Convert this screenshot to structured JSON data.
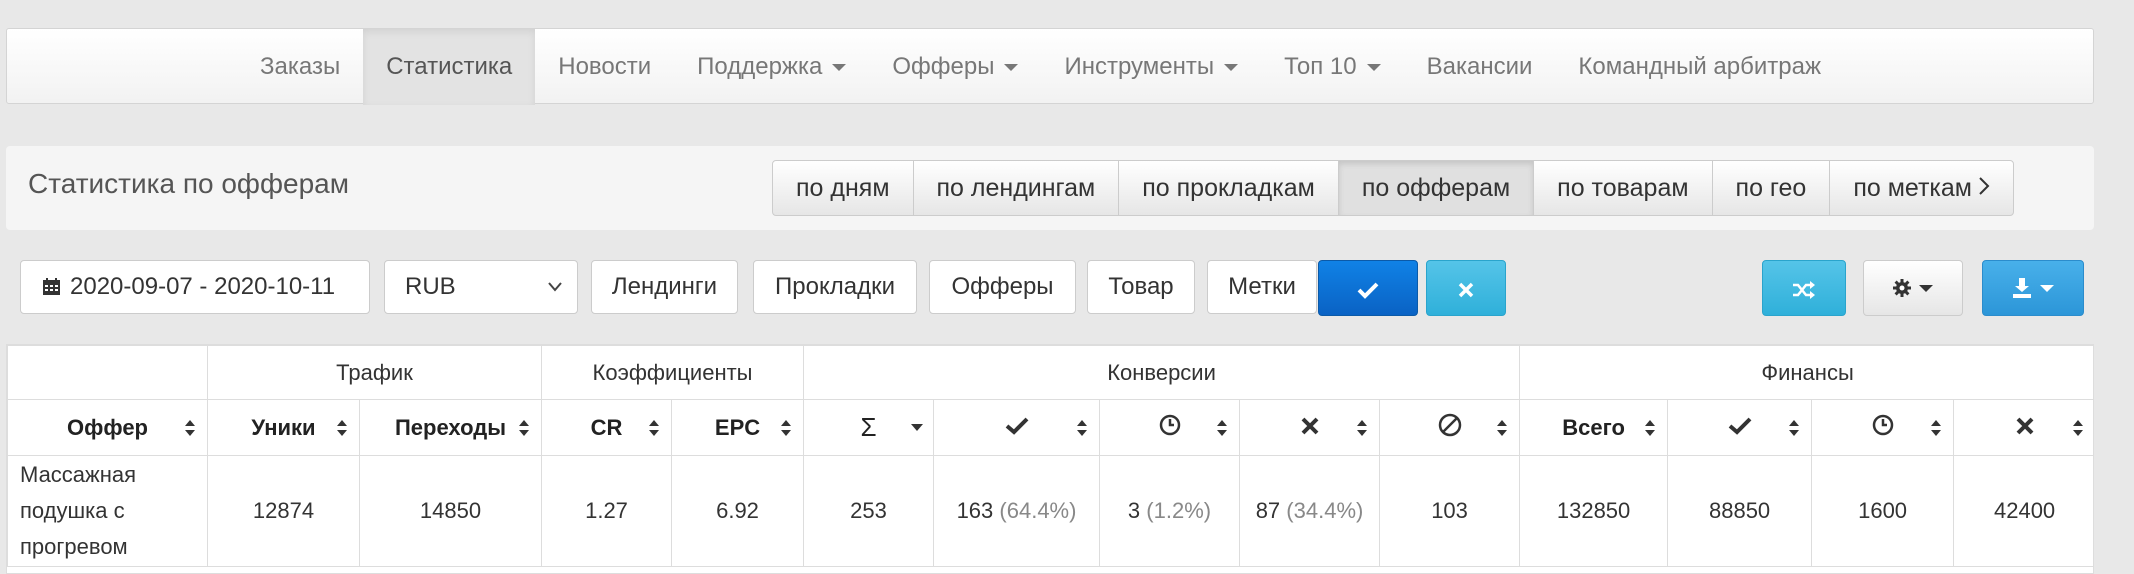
{
  "navbar": {
    "items": [
      {
        "label": "Заказы",
        "dropdown": false
      },
      {
        "label": "Статистика",
        "dropdown": false,
        "active": true
      },
      {
        "label": "Новости",
        "dropdown": false
      },
      {
        "label": "Поддержка",
        "dropdown": true
      },
      {
        "label": "Офферы",
        "dropdown": true
      },
      {
        "label": "Инструменты",
        "dropdown": true
      },
      {
        "label": "Топ 10",
        "dropdown": true
      },
      {
        "label": "Вакансии",
        "dropdown": false
      },
      {
        "label": "Командный арбитраж",
        "dropdown": false
      }
    ]
  },
  "header": {
    "title": "Статистика по офферам",
    "tabs": [
      {
        "label": "по дням"
      },
      {
        "label": "по лендингам"
      },
      {
        "label": "по прокладкам"
      },
      {
        "label": "по офферам",
        "active": true
      },
      {
        "label": "по товарам"
      },
      {
        "label": "по гео"
      },
      {
        "label": "по меткам"
      }
    ]
  },
  "filters": {
    "date_range": "2020-09-07 - 2020-10-11",
    "currency": "RUB",
    "buttons": {
      "landings": "Лендинги",
      "prelandings": "Прокладки",
      "offers": "Офферы",
      "product": "Товар",
      "tags": "Метки"
    }
  },
  "table": {
    "groups": {
      "traffic": "Трафик",
      "coefficients": "Коэффициенты",
      "conversions": "Конверсии",
      "finance": "Финансы"
    },
    "columns": {
      "offer": "Оффер",
      "uniques": "Уники",
      "clicks": "Переходы",
      "cr": "CR",
      "epc": "EPC",
      "conv_total": "Σ",
      "fin_total": "Всего"
    },
    "rows": [
      {
        "offer": "Массажная подушка с прогревом",
        "uniques": "12874",
        "clicks": "14850",
        "cr": "1.27",
        "epc": "6.92",
        "conv_total": "253",
        "approved": "163",
        "approved_pct": "(64.4%)",
        "hold": "3",
        "hold_pct": "(1.2%)",
        "rejected": "87",
        "rejected_pct": "(34.4%)",
        "trash": "103",
        "fin_total": "132850",
        "fin_approved": "88850",
        "fin_hold": "1600",
        "fin_rejected": "42400"
      }
    ]
  },
  "colors": {
    "primary": "#0a6fd6",
    "info": "#3db8e0",
    "link": "#2a8ab8"
  }
}
